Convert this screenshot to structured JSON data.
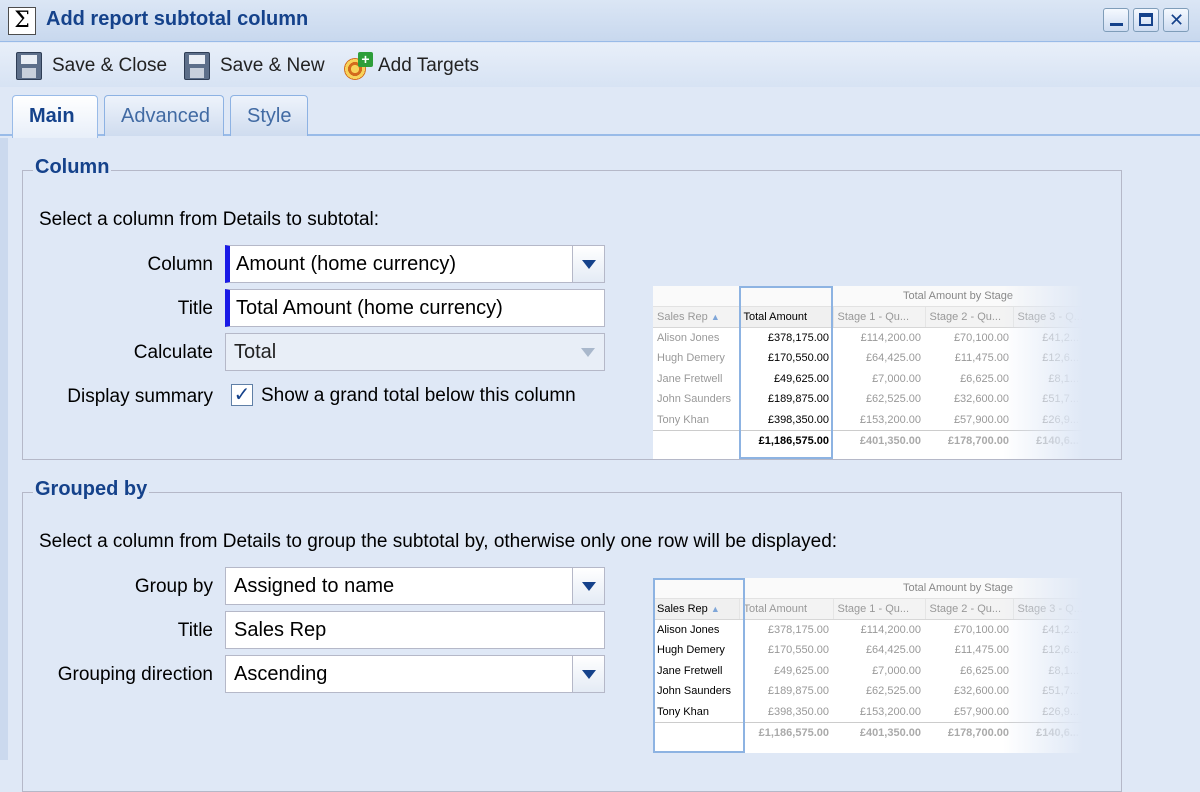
{
  "window": {
    "title": "Add report subtotal column",
    "icon": "sigma-icon",
    "controls": {
      "minimize_icon": "minimize-icon",
      "maximize_icon": "maximize-icon",
      "close_glyph": "✕"
    }
  },
  "toolbar": {
    "save_close_label": "Save & Close",
    "save_new_label": "Save & New",
    "add_targets_label": "Add Targets"
  },
  "tabs": [
    {
      "label": "Main",
      "active": true
    },
    {
      "label": "Advanced",
      "active": false
    },
    {
      "label": "Style",
      "active": false
    }
  ],
  "column_section": {
    "legend": "Column",
    "intro": "Select a column from Details to subtotal:",
    "column": {
      "label": "Column",
      "value": "Amount (home currency)"
    },
    "title": {
      "label": "Title",
      "value": "Total Amount (home currency)"
    },
    "calculate": {
      "label": "Calculate",
      "value": "Total"
    },
    "display_summary": {
      "label": "Display summary",
      "checked": true,
      "check_glyph": "✓",
      "checkbox_label": "Show a grand total below this column"
    }
  },
  "grouped_section": {
    "legend": "Grouped by",
    "intro": "Select a column from Details to group the subtotal by, otherwise only one row will be displayed:",
    "group_by": {
      "label": "Group by",
      "value": "Assigned to name"
    },
    "title": {
      "label": "Title",
      "value": "Sales Rep"
    },
    "direction": {
      "label": "Grouping direction",
      "value": "Ascending"
    }
  },
  "preview": {
    "group_header": "Total Amount by Stage",
    "sort_glyph": "▲",
    "headers": [
      "Sales Rep",
      "Total Amount",
      "Stage 1 - Qu...",
      "Stage 2 - Qu...",
      "Stage 3 - Q..."
    ],
    "rows": [
      [
        "Alison Jones",
        "£378,175.00",
        "£114,200.00",
        "£70,100.00",
        "£41,2..."
      ],
      [
        "Hugh Demery",
        "£170,550.00",
        "£64,425.00",
        "£11,475.00",
        "£12,6..."
      ],
      [
        "Jane Fretwell",
        "£49,625.00",
        "£7,000.00",
        "£6,625.00",
        "£8,1..."
      ],
      [
        "John Saunders",
        "£189,875.00",
        "£62,525.00",
        "£32,600.00",
        "£51,7..."
      ],
      [
        "Tony Khan",
        "£398,350.00",
        "£153,200.00",
        "£57,900.00",
        "£26,9..."
      ]
    ],
    "totals": [
      "",
      "£1,186,575.00",
      "£401,350.00",
      "£178,700.00",
      "£140,6..."
    ]
  }
}
